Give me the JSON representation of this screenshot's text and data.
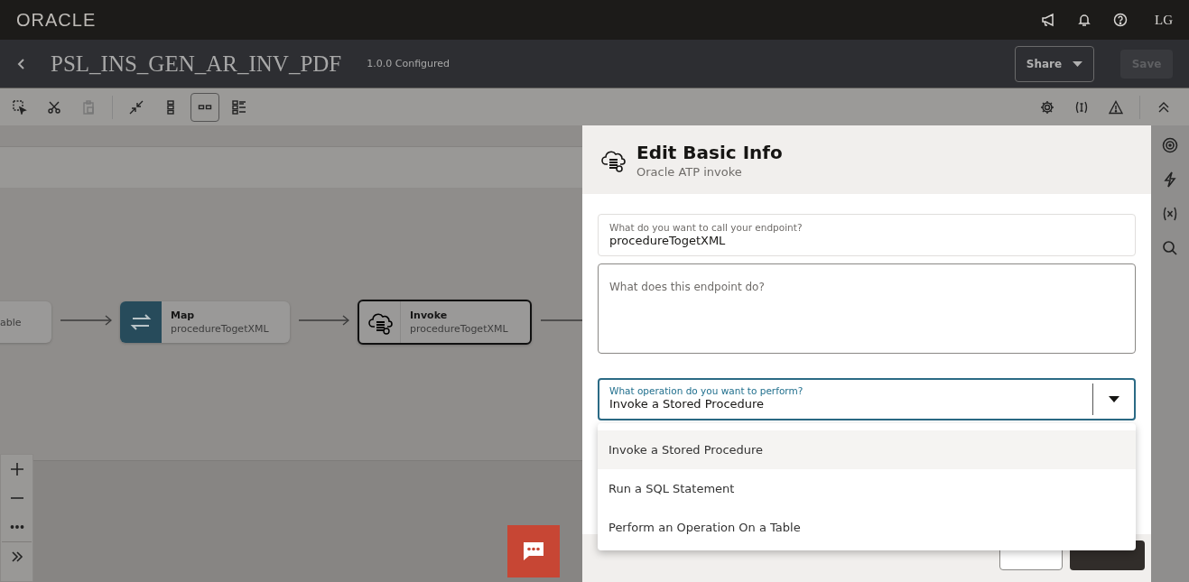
{
  "brand": {
    "logo": "ORACLE"
  },
  "top_bar": {
    "user_initials": "LG"
  },
  "header": {
    "title": "PSL_INS_GEN_AR_INV_PDF",
    "version": "1.0.0 Configured",
    "share_button": "Share",
    "save_button": {
      "label": "Save",
      "disabled": true
    }
  },
  "toolbar": {
    "paste_disabled": true,
    "view_modes": [
      {
        "kind": "vertical",
        "selected": false
      },
      {
        "kind": "horizontal",
        "selected": true
      },
      {
        "kind": "details",
        "selected": false
      }
    ]
  },
  "canvas": {
    "nodes": [
      {
        "kind": "partial",
        "subtitle": "able",
        "selected": false
      },
      {
        "kind": "map",
        "title": "Map",
        "subtitle": "procedureTogetXML",
        "selected": false
      },
      {
        "kind": "invoke",
        "title": "Invoke",
        "subtitle": "procedureTogetXML",
        "selected": true
      }
    ]
  },
  "panel": {
    "title": "Edit Basic Info",
    "subtitle": "Oracle ATP invoke",
    "fields": [
      {
        "kind": "text",
        "label": "What do you want to call your endpoint?",
        "value": "procedureTogetXML"
      },
      {
        "kind": "textarea",
        "placeholder": "What does this endpoint do?"
      },
      {
        "kind": "select",
        "label": "What operation do you want to perform?",
        "value": "Invoke a Stored Procedure",
        "expanded": true,
        "options": [
          {
            "label": "Invoke a Stored Procedure",
            "selected": true
          },
          {
            "label": "Run a SQL Statement",
            "selected": false
          },
          {
            "label": "Perform an Operation On a Table",
            "selected": false
          }
        ]
      }
    ]
  }
}
